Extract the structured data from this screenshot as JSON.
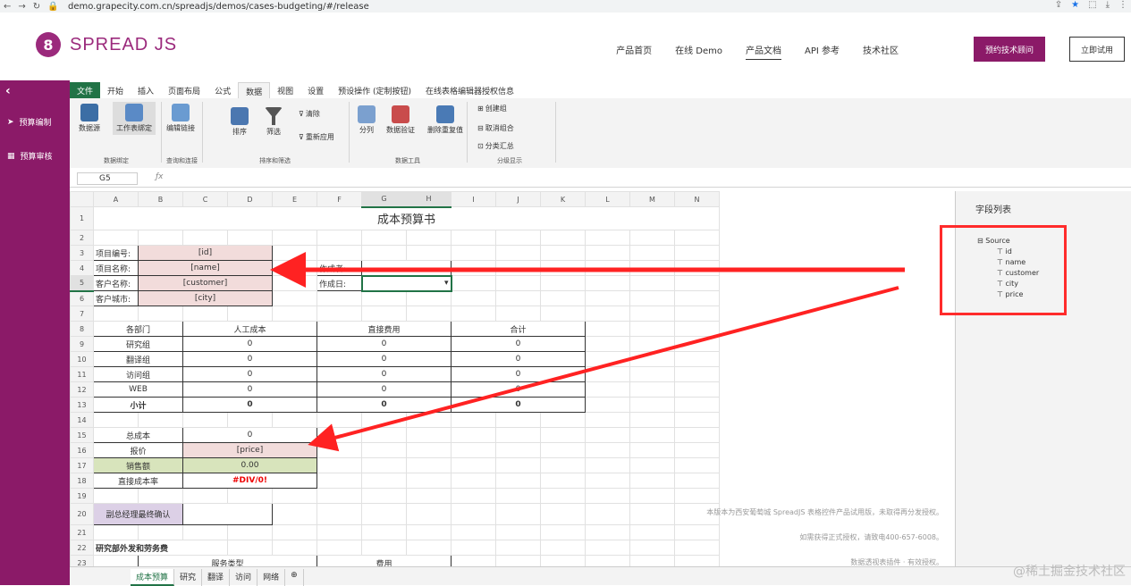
{
  "browser": {
    "url": "demo.grapecity.com.cn/spreadjs/demos/cases-budgeting/#/release"
  },
  "site": {
    "logo": "SPREAD JS",
    "nav": [
      "产品首页",
      "在线 Demo",
      "产品文档",
      "API 参考",
      "技术社区"
    ],
    "consult": "预约技术顾问",
    "trial": "立即试用"
  },
  "sidebar": {
    "items": [
      "预算编制",
      "预算审核"
    ]
  },
  "ribbon": {
    "tabs": [
      "文件",
      "开始",
      "插入",
      "页面布局",
      "公式",
      "数据",
      "视图",
      "设置",
      "预设操作 (定制按钮)",
      "在线表格编辑器授权信息"
    ],
    "tools": {
      "datasource": "数据源",
      "binding": "工作表绑定",
      "editlink": "编辑链接",
      "sort": "排序",
      "filter": "筛选",
      "clear": "清除",
      "reapply": "重新应用",
      "split": "分列",
      "validate": "数据验证",
      "dedupe": "删除重复值",
      "group": "创建组",
      "ungroup": "取消组合",
      "subtotal": "分类汇总"
    },
    "groups": {
      "binding": "数据绑定",
      "query": "查询和连接",
      "sortfilter": "排序和筛选",
      "datatools": "数据工具",
      "outline": "分级显示"
    }
  },
  "namebox": "G5",
  "sheet": {
    "cols": [
      "A",
      "B",
      "C",
      "D",
      "E",
      "F",
      "G",
      "H",
      "I",
      "J",
      "K",
      "L",
      "M",
      "N"
    ],
    "title": "成本预算书",
    "proj": [
      [
        "项目编号:",
        "[id]"
      ],
      [
        "项目名称:",
        "[name]"
      ],
      [
        "客户名称:",
        "[customer]"
      ],
      [
        "客户城市:",
        "[city]"
      ]
    ],
    "maker": "作成者:",
    "date": "作成日:",
    "dept_head": [
      "各部门",
      "人工成本",
      "直接费用",
      "合计"
    ],
    "depts": [
      [
        "研究组",
        "0",
        "0",
        "0"
      ],
      [
        "翻译组",
        "0",
        "0",
        "0"
      ],
      [
        "访问组",
        "0",
        "0",
        "0"
      ],
      [
        "WEB",
        "0",
        "0",
        "0"
      ]
    ],
    "subtotal": [
      "小计",
      "0",
      "0",
      "0"
    ],
    "total_label": "总成本",
    "total": "0",
    "price_label": "报价",
    "price": "[price]",
    "sales_label": "销售额",
    "sales": "0.00",
    "rate_label": "直接成本率",
    "rate": "#DIV/0!",
    "vp": "副总经理最终确认",
    "r22": "研究部外发和劳务费",
    "r23a": "服务类型",
    "r23b": "费用"
  },
  "fields": {
    "title": "字段列表",
    "root": "Source",
    "items": [
      "id",
      "name",
      "customer",
      "city",
      "price"
    ]
  },
  "watermark": [
    "本版本为西安葡萄城 SpreadJS 表格控件产品试用版，未取得再分发授权。",
    "如需获得正式授权，请致电400-657-6008。",
    "数据透视表插件 · 有效授权。"
  ],
  "sheettabs": [
    "成本预算",
    "研究",
    "翻译",
    "访问",
    "网络"
  ],
  "credit": "@稀土掘金技术社区"
}
